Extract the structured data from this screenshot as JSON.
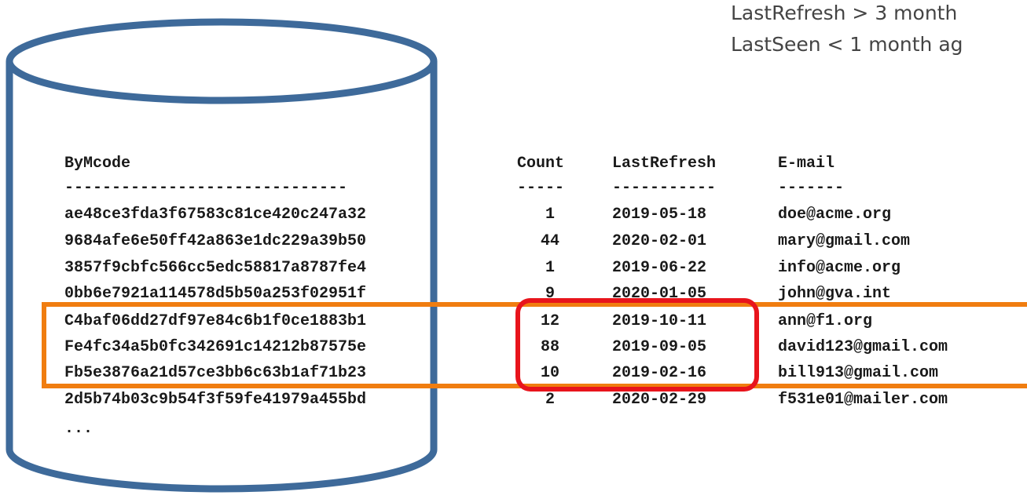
{
  "conditions": {
    "line1": "LastRefresh > 3 month",
    "line2": "LastSeen < 1 month ag"
  },
  "table": {
    "headers": {
      "code": "ByMcode",
      "count": "Count",
      "last_refresh": "LastRefresh",
      "email": "E-mail"
    },
    "separators": {
      "code": "------------------------------",
      "count": "-----",
      "last_refresh": "-----------",
      "email": "-------"
    },
    "rows": [
      {
        "code": "ae48ce3fda3f67583c81ce420c247a32",
        "count": "1",
        "last_refresh": "2019-05-18",
        "email": "doe@acme.org"
      },
      {
        "code": "9684afe6e50ff42a863e1dc229a39b50",
        "count": "44",
        "last_refresh": "2020-02-01",
        "email": "mary@gmail.com"
      },
      {
        "code": "3857f9cbfc566cc5edc58817a8787fe4",
        "count": "1",
        "last_refresh": "2019-06-22",
        "email": "info@acme.org"
      },
      {
        "code": "0bb6e7921a114578d5b50a253f02951f",
        "count": "9",
        "last_refresh": "2020-01-05",
        "email": "john@gva.int"
      },
      {
        "code": "C4baf06dd27df97e84c6b1f0ce1883b1",
        "count": "12",
        "last_refresh": "2019-10-11",
        "email": "ann@f1.org"
      },
      {
        "code": "Fe4fc34a5b0fc342691c14212b87575e",
        "count": "88",
        "last_refresh": "2019-09-05",
        "email": "david123@gmail.com"
      },
      {
        "code": "Fb5e3876a21d57ce3bb6c63b1af71b23",
        "count": "10",
        "last_refresh": "2019-02-16",
        "email": "bill913@gmail.com"
      },
      {
        "code": "2d5b74b03c9b54f3f59fe41979a455bd",
        "count": "2",
        "last_refresh": "2020-02-29",
        "email": "f531e01@mailer.com"
      }
    ],
    "ellipsis": "..."
  },
  "colors": {
    "database_outline": "#3e6a9a",
    "row_highlight": "#f07d10",
    "cell_highlight": "#e8141c"
  }
}
